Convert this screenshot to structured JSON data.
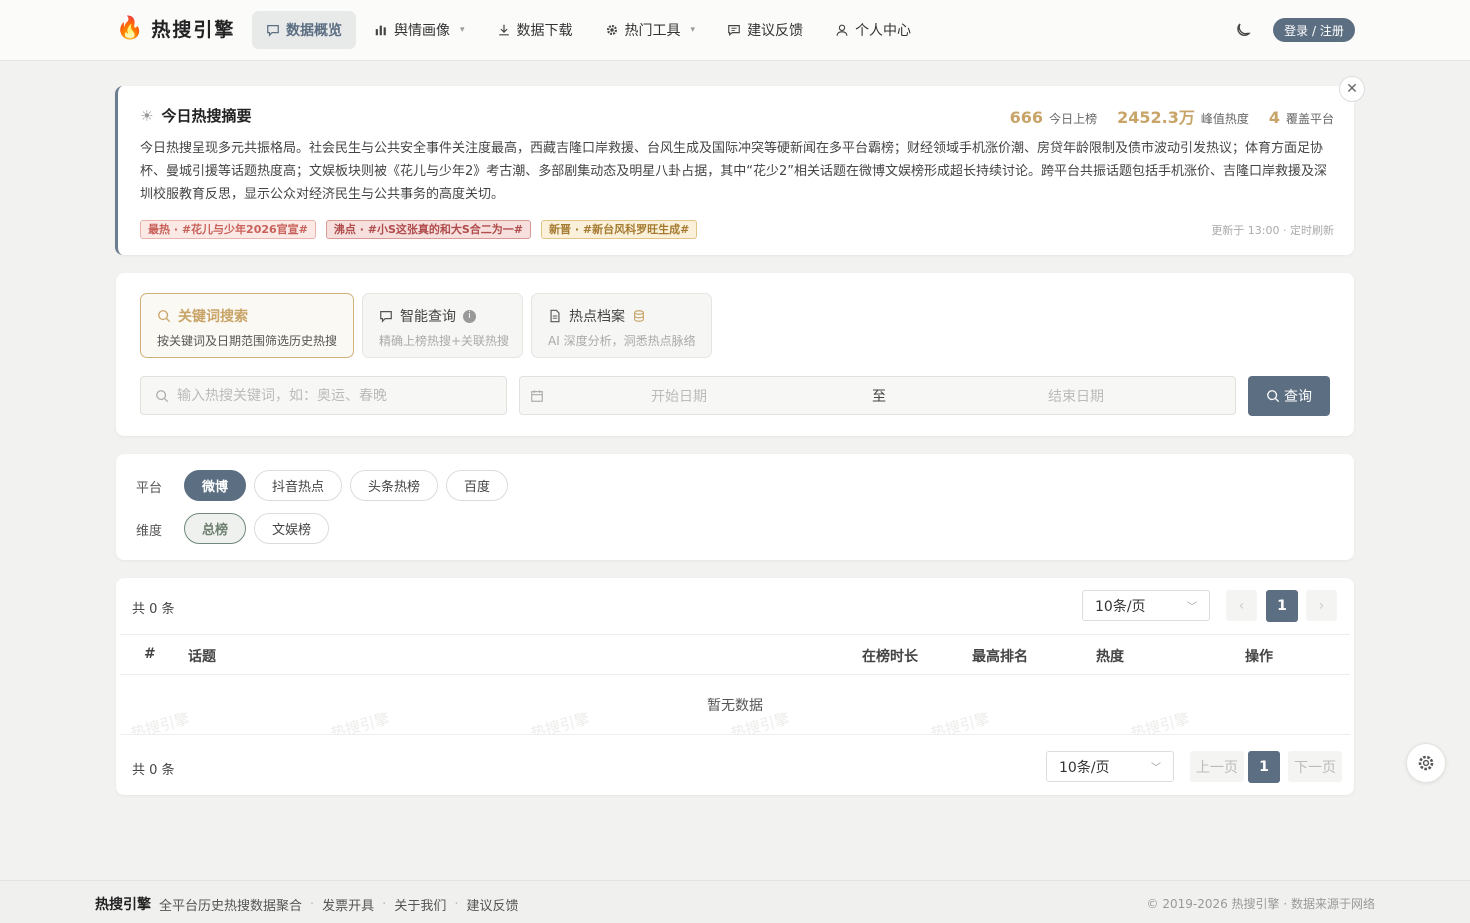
{
  "header": {
    "logo_text": "热搜引擎",
    "nav": [
      {
        "label": "数据概览",
        "icon": "chat-icon",
        "active": true,
        "chevron": false
      },
      {
        "label": "舆情画像",
        "icon": "bar-chart-icon",
        "active": false,
        "chevron": true
      },
      {
        "label": "数据下载",
        "icon": "download-icon",
        "active": false,
        "chevron": false
      },
      {
        "label": "热门工具",
        "icon": "gear-icon",
        "active": false,
        "chevron": true
      },
      {
        "label": "建议反馈",
        "icon": "message-icon",
        "active": false,
        "chevron": false
      },
      {
        "label": "个人中心",
        "icon": "user-icon",
        "active": false,
        "chevron": false
      }
    ],
    "login_label": "登录 / 注册"
  },
  "summary": {
    "title": "今日热搜摘要",
    "stats": [
      {
        "value": "666",
        "label": "今日上榜"
      },
      {
        "value": "2452.3万",
        "label": "峰值热度"
      },
      {
        "value": "4",
        "label": "覆盖平台"
      }
    ],
    "text": "今日热搜呈现多元共振格局。社会民生与公共安全事件关注度最高，西藏吉隆口岸救援、台风生成及国际冲突等硬新闻在多平台霸榜；财经领域手机涨价潮、房贷年龄限制及债市波动引发热议；体育方面足协杯、曼城引援等话题热度高；文娱板块则被《花儿与少年2》考古潮、多部剧集动态及明星八卦占据，其中“花少2”相关话题在微博文娱榜形成超长持续讨论。跨平台共振话题包括手机涨价、吉隆口岸救援及深圳校服教育反思，显示公众对经济民生与公共事务的高度关切。",
    "tags": [
      {
        "label": "最热 · #花儿与少年2026官宣#",
        "kind": "hot"
      },
      {
        "label": "沸点 · #小S这张真的和大S合二为一#",
        "kind": "boil"
      },
      {
        "label": "新晋 · #新台风科罗旺生成#",
        "kind": "new"
      }
    ],
    "update": "更新于 13:00 · 定时刷新"
  },
  "search": {
    "modes": [
      {
        "title": "关键词搜索",
        "sub": "按关键词及日期范围筛选历史热搜",
        "active": true
      },
      {
        "title": "智能查询",
        "sub": "精确上榜热搜+关联热搜",
        "active": false
      },
      {
        "title": "热点档案",
        "sub": "AI 深度分析，洞悉热点脉络",
        "active": false
      }
    ],
    "keyword_placeholder": "输入热搜关键词，如：奥运、春晚",
    "start_date": "开始日期",
    "separator": "至",
    "end_date": "结束日期",
    "query_label": "查询"
  },
  "filters": {
    "platform_label": "平台",
    "platforms": [
      "微博",
      "抖音热点",
      "头条热榜",
      "百度"
    ],
    "dimension_label": "维度",
    "dimensions": [
      "总榜",
      "文娱榜"
    ]
  },
  "table": {
    "count_text": "共 0 条",
    "page_size": "10条/页",
    "current_page": "1",
    "columns": [
      "#",
      "话题",
      "在榜时长",
      "最高排名",
      "热度",
      "操作"
    ],
    "empty_text": "暂无数据",
    "watermark": "热搜引擎",
    "prev_label": "上一页",
    "next_label": "下一页"
  },
  "footer": {
    "brand": "热搜引擎",
    "tagline": "全平台历史热搜数据聚合",
    "links": [
      "发票开具",
      "关于我们",
      "建议反馈"
    ],
    "copyright": "© 2019-2026 热搜引擎 · 数据来源于网络"
  }
}
